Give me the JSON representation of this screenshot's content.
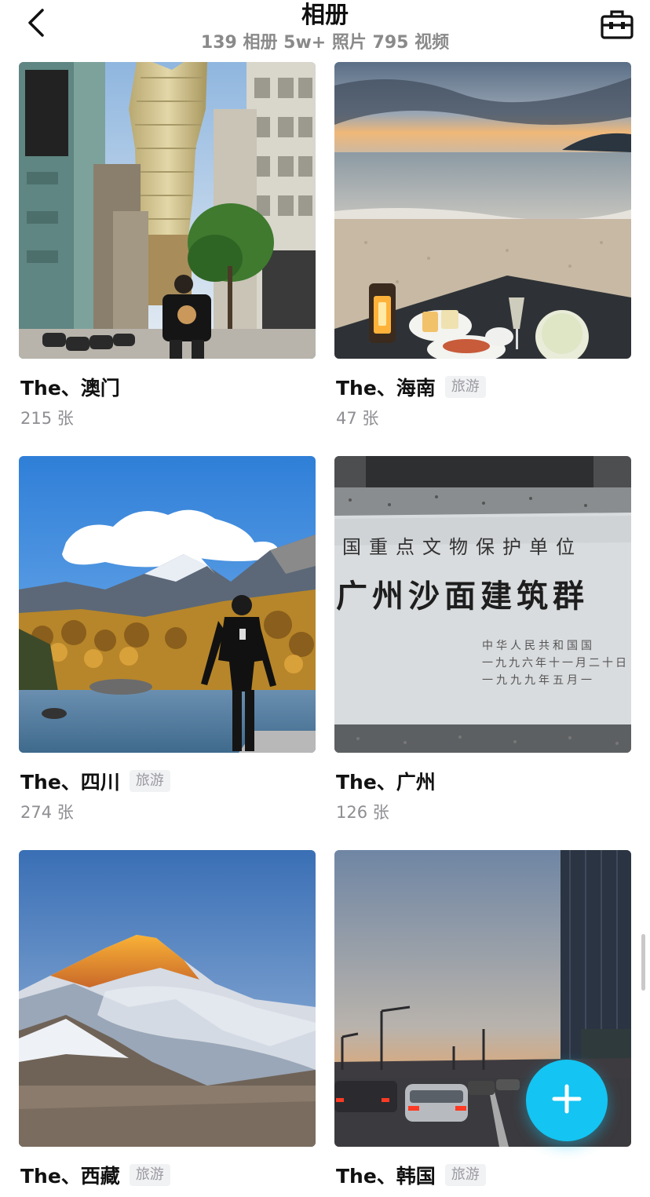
{
  "header": {
    "title": "相册",
    "subtitle": "139 相册 5w+ 照片 795 视频",
    "back_icon": "chevron-left-icon",
    "toolbox_icon": "toolbox-icon"
  },
  "albums": [
    {
      "name": "The、澳门",
      "tag": "",
      "count": "215 张"
    },
    {
      "name": "The、海南",
      "tag": "旅游",
      "count": "47 张"
    },
    {
      "name": "The、四川",
      "tag": "旅游",
      "count": "274 张"
    },
    {
      "name": "The、广州",
      "tag": "",
      "count": "126 张"
    },
    {
      "name": "The、西藏",
      "tag": "旅游",
      "count": ""
    },
    {
      "name": "The、韩国",
      "tag": "旅游",
      "count": ""
    }
  ],
  "photo_text": {
    "line1": "国重点文物保护单位",
    "line2": "广州沙面建筑群",
    "line3": "中华人民共和国国",
    "line4": "一九九六年十一月二十日",
    "line5": "一九九九年五月一"
  },
  "fab": {
    "icon": "plus-icon",
    "color": "#14c4f2"
  }
}
